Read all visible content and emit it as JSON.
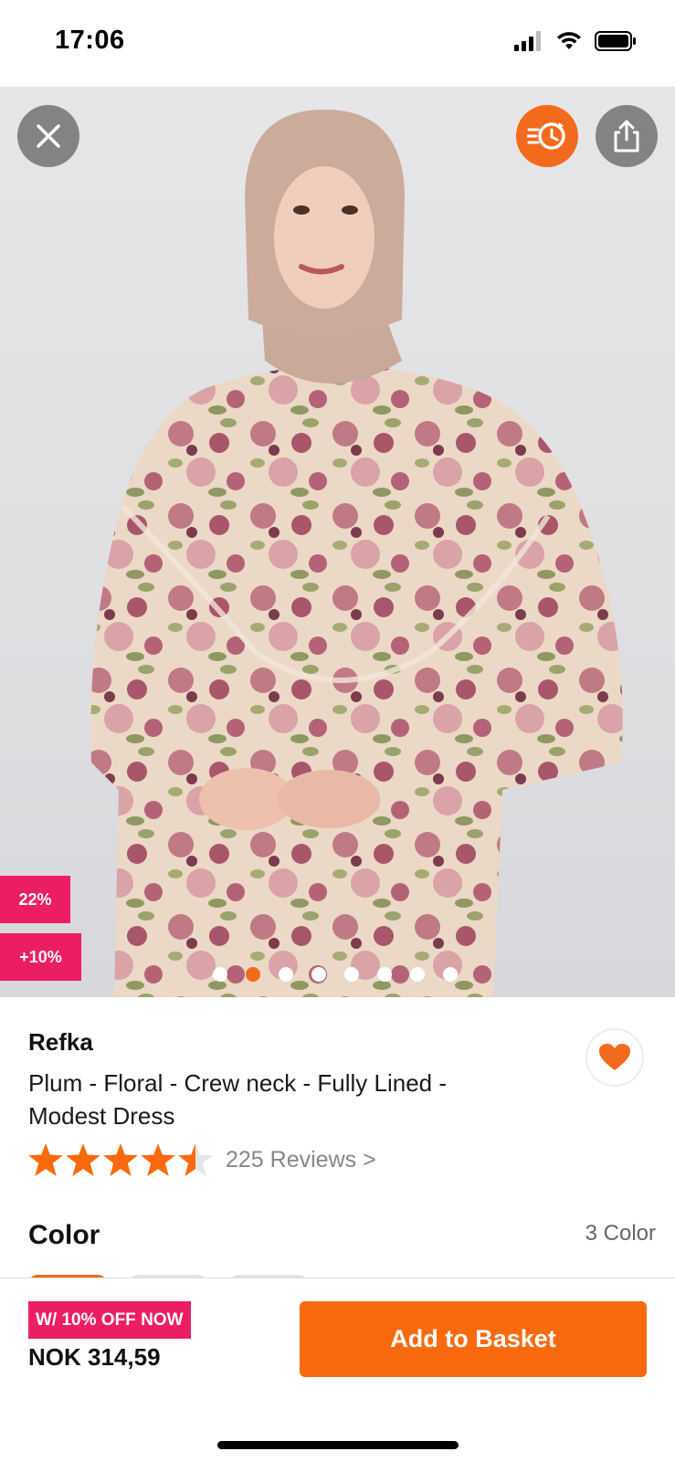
{
  "status_bar": {
    "time": "17:06",
    "signal_icon": "cellular-signal-icon",
    "wifi_icon": "wifi-icon",
    "battery_icon": "battery-icon"
  },
  "hero": {
    "close_icon": "close-icon",
    "history_icon": "recently-viewed-icon",
    "share_icon": "share-icon",
    "discount_badge": "22%",
    "extra_discount_badge": "+10%",
    "carousel": {
      "total": 8,
      "active_index": 1
    }
  },
  "product": {
    "brand": "Refka",
    "title": "Plum - Floral - Crew neck - Fully Lined - Modest Dress",
    "rating": 4.5,
    "reviews_link": "225 Reviews >",
    "favorite_icon": "heart-icon"
  },
  "color_section": {
    "label": "Color",
    "count": "3 Color",
    "swatches": [
      "#f26a1b",
      "#e3e3e3",
      "#e3e3e3"
    ]
  },
  "bottom_bar": {
    "offer_badge": "W/ 10% OFF NOW",
    "price": "NOK 314,59",
    "add_button": "Add to Basket"
  },
  "colors": {
    "accent": "#f96a0e",
    "badge": "#ec1e63"
  }
}
